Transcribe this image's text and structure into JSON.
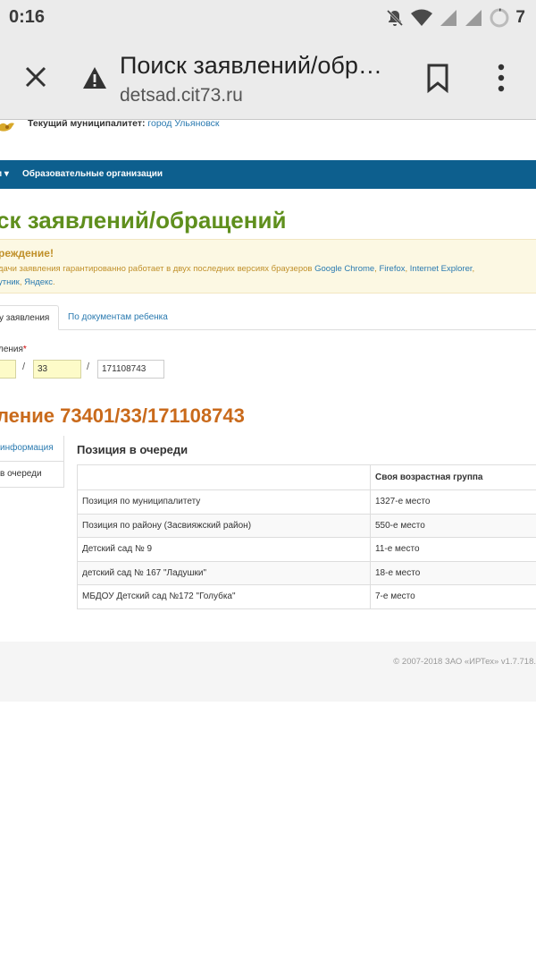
{
  "status_bar": {
    "time": "0:16",
    "battery": "7"
  },
  "toolbar": {
    "title": "Поиск заявлений/обр…",
    "url": "detsad.cit73.ru",
    "icons": [
      "close-icon",
      "warning-icon",
      "bookmark-icon",
      "more-vert-icon"
    ]
  },
  "header": {
    "municipality_label": "Текущий муниципалитет:",
    "municipality_value": "город Ульяновск"
  },
  "navbar": {
    "item_1": "и ▾",
    "item_2": "Образовательные организации"
  },
  "page_title": "ск заявлений/обращений",
  "alert": {
    "title": "реждение!",
    "text_1": "дачи заявления гарантированно работает в двух последних версиях браузеров ",
    "link_chrome": "Google Chrome",
    "sep_1": ", ",
    "link_firefox": "Firefox",
    "sep_2": ", ",
    "link_ie": "Internet Explorer",
    "sep_3": ",",
    "link_sputnik": "утник",
    "sep_4": ", ",
    "link_yandex": "Яндекс",
    "end": "."
  },
  "tabs": {
    "active": "у заявления",
    "other": "По документам ребенка"
  },
  "form": {
    "label": "ления",
    "required_mark": "*",
    "field_1": "",
    "field_2": "33",
    "field_3": "171108743",
    "slash": "/"
  },
  "application": {
    "title": "ление 73401/33/171108743"
  },
  "sidenav": {
    "item_1": "информация",
    "item_2": "в очереди"
  },
  "queue": {
    "title": "Позиция в очереди",
    "column_header": "Своя возрастная группа",
    "rows": [
      {
        "label": "Позиция по муниципалитету",
        "value": "1327-е место"
      },
      {
        "label": "Позиция по району (Засвияжский район)",
        "value": "550-е место"
      },
      {
        "label": "Детский сад № 9",
        "value": "11-е место"
      },
      {
        "label": "детский сад № 167 \"Ладушки\"",
        "value": "18-е место"
      },
      {
        "label": "МБДОУ Детский сад №172 \"Голубка\"",
        "value": "7-е место"
      }
    ]
  },
  "footer": {
    "copyright": "© 2007-2018 ЗАО «ИРТех» v1.7.718."
  },
  "colors": {
    "navbar": "#0d5f8e",
    "title_green": "#5f8f1d",
    "app_orange": "#c96a1b",
    "link_blue": "#2a7ab0",
    "alert_bg": "#fcf8e3"
  }
}
